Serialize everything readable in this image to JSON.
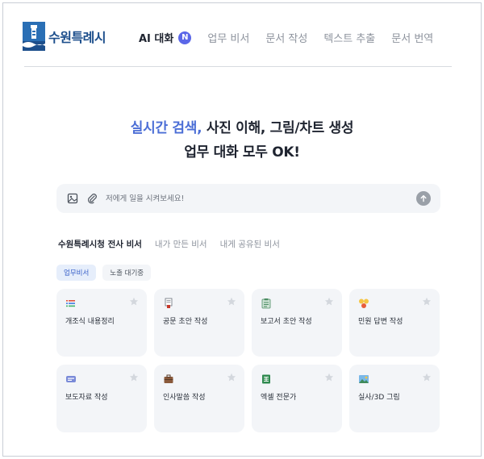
{
  "header": {
    "logo_text": "수원특례시",
    "nav": [
      {
        "label": "AI 대화",
        "badge": "N",
        "active": true
      },
      {
        "label": "업무 비서"
      },
      {
        "label": "문서 작성"
      },
      {
        "label": "텍스트 추출"
      },
      {
        "label": "문서 번역"
      }
    ]
  },
  "hero": {
    "accent": "실시간 검색,",
    "line1_rest": " 사진 이해, 그림/차트 생성",
    "line2": "업무 대화 모두 OK!"
  },
  "prompt": {
    "placeholder": "저에게 일을 시켜보세요!",
    "icons": [
      "image-icon",
      "paperclip-icon",
      "arrow-up-icon"
    ]
  },
  "tabs": [
    "수원특례시청 전사 비서",
    "내가 만든 비서",
    "내게 공유된 비서"
  ],
  "chips": [
    "업무비서",
    "노출 대기중"
  ],
  "cards": [
    {
      "label": "개조식 내용정리",
      "icon": "list-icon"
    },
    {
      "label": "공문 초안 작성",
      "icon": "document-stamp-icon"
    },
    {
      "label": "보고서 초안 작성",
      "icon": "clipboard-icon"
    },
    {
      "label": "민원 답변 작성",
      "icon": "emoji-icon"
    },
    {
      "label": "보도자료 작성",
      "icon": "press-icon"
    },
    {
      "label": "인사말씀 작성",
      "icon": "briefcase-icon"
    },
    {
      "label": "엑셀 전문가",
      "icon": "spreadsheet-icon"
    },
    {
      "label": "실사/3D 그림",
      "icon": "picture-icon"
    }
  ],
  "colors": {
    "accent": "#4b6ed6",
    "badge": "#5b67e8",
    "brand": "#1d4f8c",
    "card_bg": "#f3f5f8"
  }
}
